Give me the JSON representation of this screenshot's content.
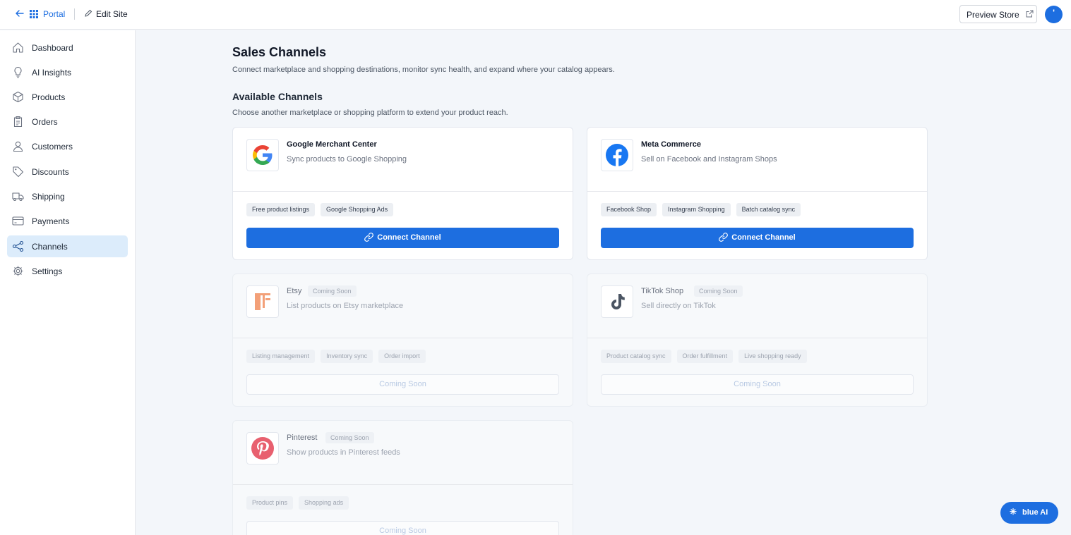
{
  "topbar": {
    "portal_label": "Portal",
    "edit_site_label": "Edit Site",
    "preview_store_label": "Preview Store",
    "avatar_text": "'"
  },
  "sidebar": {
    "items": [
      {
        "label": "Dashboard",
        "icon": "home-icon",
        "active": false
      },
      {
        "label": "AI Insights",
        "icon": "lightbulb-icon",
        "active": false
      },
      {
        "label": "Products",
        "icon": "box-icon",
        "active": false
      },
      {
        "label": "Orders",
        "icon": "clipboard-icon",
        "active": false
      },
      {
        "label": "Customers",
        "icon": "user-icon",
        "active": false
      },
      {
        "label": "Discounts",
        "icon": "tag-icon",
        "active": false
      },
      {
        "label": "Shipping",
        "icon": "truck-icon",
        "active": false
      },
      {
        "label": "Payments",
        "icon": "credit-card-icon",
        "active": false
      },
      {
        "label": "Channels",
        "icon": "share-icon",
        "active": true
      },
      {
        "label": "Settings",
        "icon": "gear-icon",
        "active": false
      }
    ]
  },
  "page": {
    "title": "Sales Channels",
    "subtitle": "Connect marketplace and shopping destinations, monitor sync health, and expand where your catalog appears.",
    "section_title": "Available Channels",
    "section_subtitle": "Choose another marketplace or shopping platform to extend your product reach."
  },
  "channels": [
    {
      "name": "Google Merchant Center",
      "description": "Sync products to Google Shopping",
      "icon": "google-logo-icon",
      "badge": "",
      "tags": [
        "Free product listings",
        "Google Shopping Ads"
      ],
      "button": "Connect Channel",
      "available": true
    },
    {
      "name": "Meta Commerce",
      "description": "Sell on Facebook and Instagram Shops",
      "icon": "facebook-logo-icon",
      "badge": "",
      "tags": [
        "Facebook Shop",
        "Instagram Shopping",
        "Batch catalog sync"
      ],
      "button": "Connect Channel",
      "available": true
    },
    {
      "name": "Etsy",
      "description": "List products on Etsy marketplace",
      "icon": "etsy-logo-icon",
      "badge": "Coming Soon",
      "tags": [
        "Listing management",
        "Inventory sync",
        "Order import"
      ],
      "button": "Coming Soon",
      "available": false
    },
    {
      "name": "TikTok Shop",
      "description": "Sell directly on TikTok",
      "icon": "tiktok-logo-icon",
      "badge": "Coming Soon",
      "tags": [
        "Product catalog sync",
        "Order fulfillment",
        "Live shopping ready"
      ],
      "button": "Coming Soon",
      "available": false
    },
    {
      "name": "Pinterest",
      "description": "Show products in Pinterest feeds",
      "icon": "pinterest-logo-icon",
      "badge": "Coming Soon",
      "tags": [
        "Product pins",
        "Shopping ads"
      ],
      "button": "Coming Soon",
      "available": false
    }
  ],
  "ai_button": {
    "label": "blue AI",
    "icon": "sparkle-icon"
  },
  "colors": {
    "accent": "#1d6ee0",
    "active_nav_bg": "#dcecfb",
    "page_bg": "#f3f6fa"
  }
}
